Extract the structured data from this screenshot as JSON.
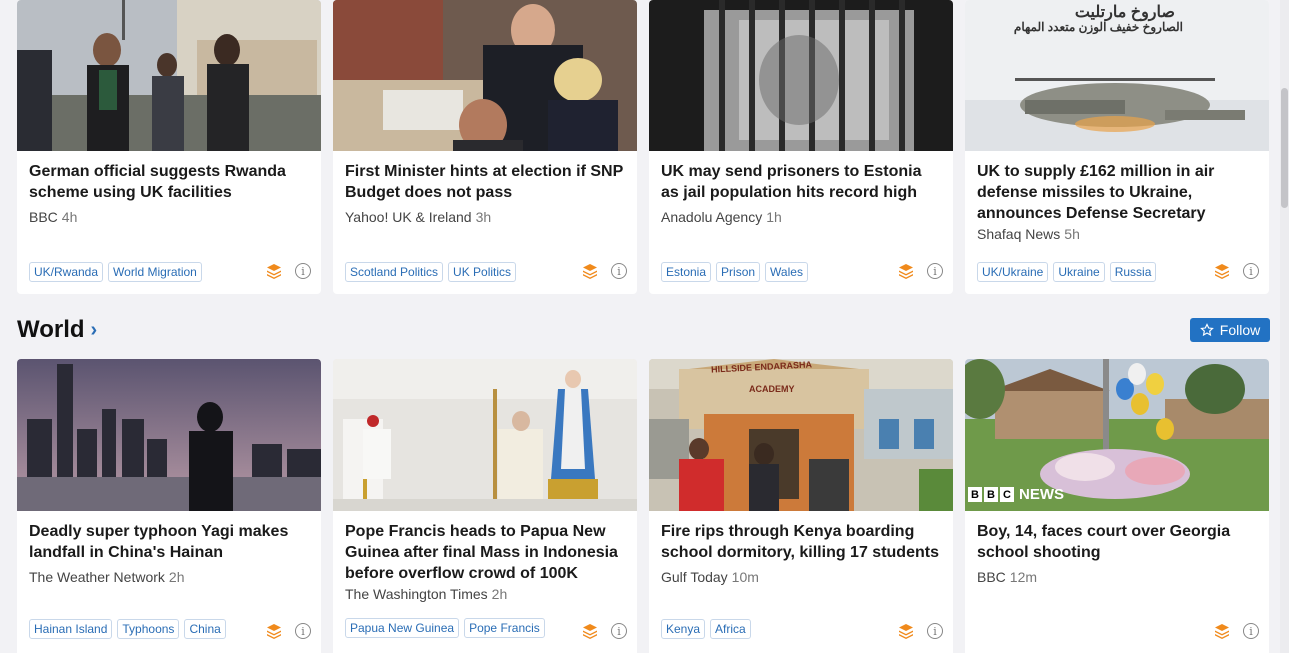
{
  "row1": [
    {
      "title": "German official suggests Rwanda scheme using UK facilities",
      "source": "BBC",
      "time": "4h",
      "tags": [
        "UK/Rwanda",
        "World Migration"
      ]
    },
    {
      "title": "First Minister hints at election if SNP Budget does not pass",
      "source": "Yahoo! UK & Ireland",
      "time": "3h",
      "tags": [
        "Scotland Politics",
        "UK Politics"
      ]
    },
    {
      "title": "UK may send prisoners to Estonia as jail population hits record high",
      "source": "Anadolu Agency",
      "time": "1h",
      "tags": [
        "Estonia",
        "Prison",
        "Wales"
      ]
    },
    {
      "title": "UK to supply £162 million in air defense missiles to Ukraine, announces Defense Secretary",
      "source": "Shafaq News",
      "time": "5h",
      "tags": [
        "UK/Ukraine",
        "Ukraine",
        "Russia"
      ],
      "image_text_1": "صاروخ مارتليت",
      "image_text_2": "الصاروخ خفيف الوزن متعدد المهام"
    }
  ],
  "section": {
    "title": "World",
    "follow_label": "Follow"
  },
  "row2": [
    {
      "title": "Deadly super typhoon Yagi makes landfall in China's Hainan",
      "source": "The Weather Network",
      "time": "2h",
      "tags": [
        "Hainan Island",
        "Typhoons",
        "China"
      ]
    },
    {
      "title": "Pope Francis heads to Papua New Guinea after final Mass in Indonesia before overflow crowd of 100K",
      "source": "The Washington Times",
      "time": "2h",
      "tags": [
        "Papua New Guinea",
        "Pope Francis"
      ]
    },
    {
      "title": "Fire rips through Kenya boarding school dormitory, killing 17 students",
      "source": "Gulf Today",
      "time": "10m",
      "tags": [
        "Kenya",
        "Africa"
      ],
      "image_text_1": "HILLSIDE ENDARASHA",
      "image_text_2": "ACADEMY"
    },
    {
      "title": "Boy, 14, faces court over Georgia school shooting",
      "source": "BBC",
      "time": "12m",
      "tags": [],
      "image_text_1": "NEWS"
    }
  ],
  "icons": {
    "stack": "stack-icon",
    "info": "info-icon",
    "star": "star-icon",
    "chevron": "chevron-right-icon"
  },
  "colors": {
    "accent": "#2272c3",
    "stack": "#f08a1c",
    "tag": "#2a6db5"
  }
}
